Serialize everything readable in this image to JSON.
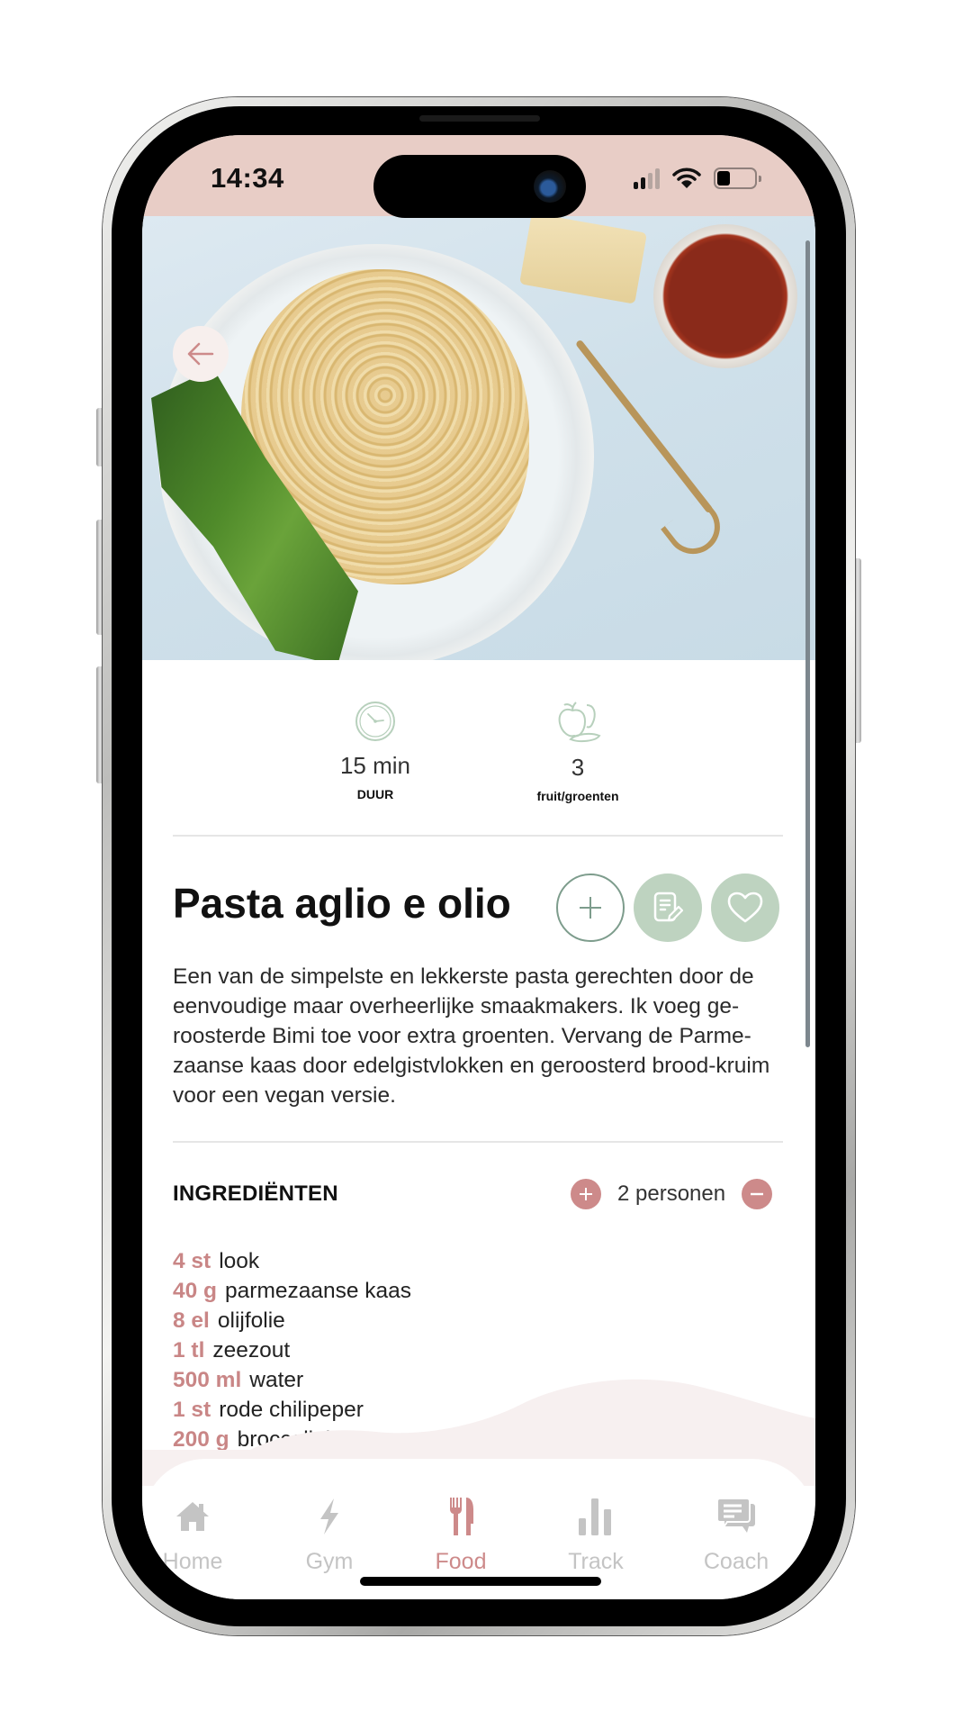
{
  "status_bar": {
    "time": "14:34",
    "signal_bars_active": 2,
    "signal_bars_total": 4,
    "battery_level_percent": 35
  },
  "hero": {
    "image_description": "Plate of spaghetti aglio e olio with broccolini, parmesan block and bowl of chili flakes",
    "back_icon": "arrow-left-icon"
  },
  "info": [
    {
      "icon": "clock-icon",
      "value": "15 min",
      "label": "DUUR"
    },
    {
      "icon": "fruit-vegetables-icon",
      "value": "3",
      "label": "fruit/groenten"
    }
  ],
  "recipe": {
    "title": "Pasta aglio e olio",
    "actions": [
      {
        "name": "add",
        "icon": "plus-icon"
      },
      {
        "name": "notes",
        "icon": "note-edit-icon"
      },
      {
        "name": "favorite",
        "icon": "heart-icon"
      }
    ],
    "description": "Een van de simpelste en lekkerste pasta gerechten door de eenvoudige maar overheerlijke smaakmakers. Ik voeg ge-roosterde Bimi toe voor extra groenten. Vervang de Parme-zaanse kaas door edelgistvlokken en geroosterd brood-kruim voor een vegan versie."
  },
  "ingredients": {
    "header": "INGREDIËNTEN",
    "servings_label": "2 personen",
    "items": [
      {
        "qty": "4 st",
        "name": "look"
      },
      {
        "qty": "40 g",
        "name": "parmezaanse kaas"
      },
      {
        "qty": "8 el",
        "name": "olijfolie"
      },
      {
        "qty": "1 tl",
        "name": "zeezout"
      },
      {
        "qty": "500 ml",
        "name": "water"
      },
      {
        "qty": "1 st",
        "name": "rode chilipeper"
      },
      {
        "qty": "200 g",
        "name": "broccolini"
      }
    ]
  },
  "nav": {
    "active": "Food",
    "items": [
      {
        "label": "Home",
        "icon": "home-icon"
      },
      {
        "label": "Gym",
        "icon": "lightning-icon"
      },
      {
        "label": "Food",
        "icon": "fork-knife-icon"
      },
      {
        "label": "Track",
        "icon": "bar-chart-icon"
      },
      {
        "label": "Coach",
        "icon": "chat-icon"
      }
    ]
  },
  "colors": {
    "accent_pink": "#cd8a8a",
    "status_bar_bg": "#e8cdc6",
    "action_green": "#bed3c0",
    "nav_inactive": "#c4c4c4"
  }
}
